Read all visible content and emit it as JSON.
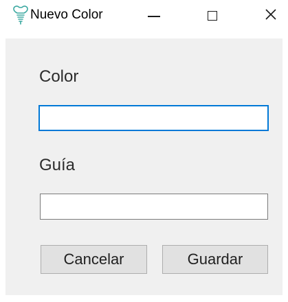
{
  "window": {
    "title": "Nuevo Color",
    "icon": "tooth-implant-icon",
    "accent_color": "#0078d7",
    "client_background": "#f0f0f0"
  },
  "form": {
    "color_label": "Color",
    "color_value": "",
    "guia_label": "Guía",
    "guia_value": ""
  },
  "actions": {
    "cancel_label": "Cancelar",
    "save_label": "Guardar"
  }
}
